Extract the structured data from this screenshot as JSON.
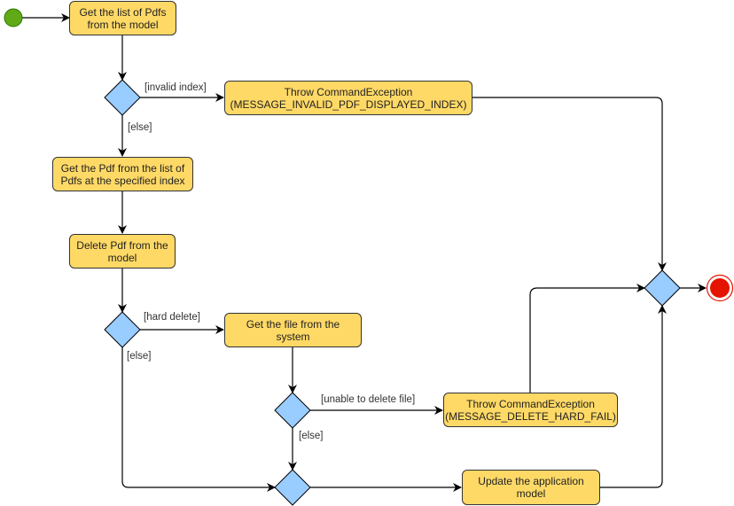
{
  "colors": {
    "action_fill": "#FFD966",
    "decision_fill": "#99CCFF",
    "start": "#60A917",
    "end": "#E51400"
  },
  "actions": {
    "get_list": "Get the list of Pdfs from the model",
    "throw_invalid": "Throw CommandException (MESSAGE_INVALID_PDF_DISPLAYED_INDEX)",
    "get_pdf": "Get the Pdf from the list of Pdfs at the specified index",
    "delete_pdf": "Delete Pdf from the model",
    "get_file": "Get the file from the system",
    "throw_hard_fail": "Throw CommandException (MESSAGE_DELETE_HARD_FAIL)",
    "update_model": "Update the application model"
  },
  "guards": {
    "invalid_index": "[invalid index]",
    "else1": "[else]",
    "hard_delete": "[hard delete]",
    "else2": "[else]",
    "unable_delete": "[unable to delete file]",
    "else3": "[else]"
  }
}
